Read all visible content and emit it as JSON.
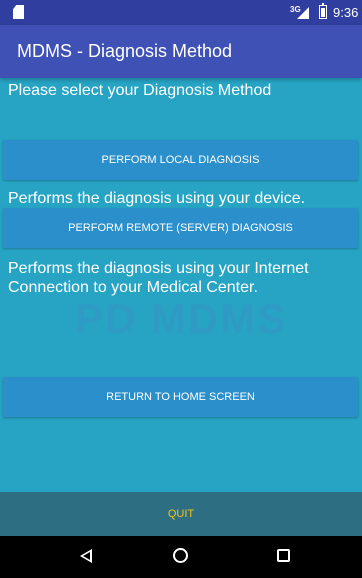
{
  "status_bar": {
    "network_type": "3G",
    "time": "9:36"
  },
  "app_bar": {
    "title": "MDMS - Diagnosis Method"
  },
  "content": {
    "prompt": "Please select your Diagnosis Method",
    "local_button": "PERFORM LOCAL DIAGNOSIS",
    "local_description": "Performs the diagnosis using your device.",
    "remote_button": "PERFORM REMOTE (SERVER) DIAGNOSIS",
    "remote_description": "Performs the diagnosis using your Internet Connection to your Medical Center.",
    "watermark": "PD MDMS",
    "home_button": "RETURN TO HOME SCREEN",
    "quit_button": "QUIT"
  },
  "nav_bar": {
    "icons": [
      "back-icon",
      "home-icon",
      "recents-icon"
    ]
  },
  "colors": {
    "status_bar": "#303f9f",
    "app_bar": "#3f51b5",
    "background": "#27a4c4",
    "button": "#2b8fcb",
    "quit_bar": "#2e6e82",
    "quit_text": "#f2c418"
  }
}
